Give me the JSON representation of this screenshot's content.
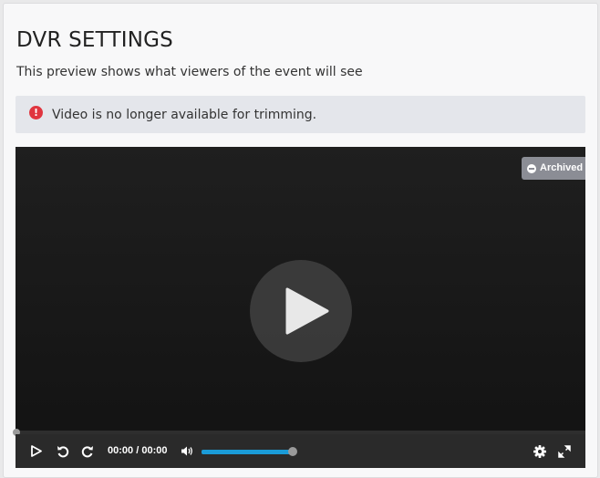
{
  "header": {
    "title": "DVR SETTINGS",
    "subtitle": "This preview shows what viewers of the event will see"
  },
  "alert": {
    "icon": "exclamation-icon",
    "message": "Video is no longer available for trimming.",
    "icon_color": "#e0353f",
    "background": "#e4e6eb"
  },
  "player": {
    "badge_label": "Archived",
    "current_time": "00:00",
    "separator": "/",
    "duration": "00:00",
    "progress_fraction": 0,
    "volume_fraction": 1.0,
    "accent_color": "#1a9bd7",
    "icons": {
      "big_play": "play-icon",
      "play": "play-icon",
      "rewind": "rewind-icon",
      "forward": "forward-icon",
      "volume": "volume-icon",
      "settings": "gear-icon",
      "fullscreen": "fullscreen-icon",
      "badge": "minus-circle-icon"
    }
  }
}
